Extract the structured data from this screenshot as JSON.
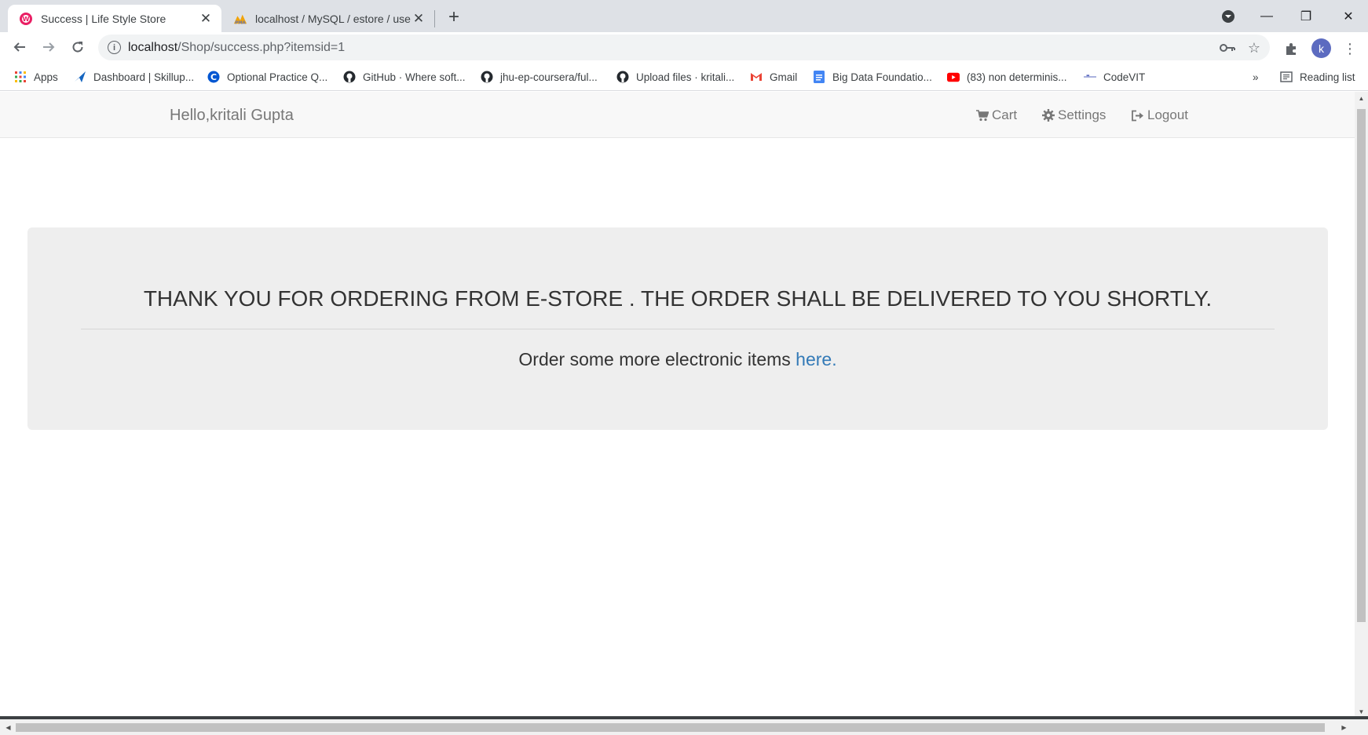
{
  "browser": {
    "tabs": [
      {
        "title": "Success | Life Style Store",
        "favicon": "store-favicon",
        "active": true
      },
      {
        "title": "localhost / MySQL / estore / user",
        "favicon": "phpmyadmin-favicon",
        "active": false
      }
    ],
    "new_tab_icon": "plus-icon",
    "address": {
      "host": "localhost",
      "path": "/Shop/success.php?itemsid=1"
    },
    "avatar_letter": "k",
    "bookmarks": [
      {
        "label": "Apps",
        "icon": "apps-grid-icon"
      },
      {
        "label": "Dashboard | Skillup...",
        "icon": "skillup-icon"
      },
      {
        "label": "Optional Practice Q...",
        "icon": "coursera-icon"
      },
      {
        "label": "GitHub · Where soft...",
        "icon": "github-icon"
      },
      {
        "label": "jhu-ep-coursera/ful...",
        "icon": "github-icon"
      },
      {
        "label": "Upload files · kritali...",
        "icon": "github-icon"
      },
      {
        "label": "Gmail",
        "icon": "gmail-icon"
      },
      {
        "label": "Big Data Foundatio...",
        "icon": "docs-icon"
      },
      {
        "label": "(83) non determinis...",
        "icon": "youtube-icon"
      },
      {
        "label": "CodeVIT",
        "icon": "codevit-icon"
      }
    ],
    "more_bookmarks": "»",
    "reading_list": "Reading list"
  },
  "page": {
    "navbar": {
      "greeting": "Hello,kritali Gupta",
      "links": [
        {
          "label": "Cart",
          "icon": "cart-icon"
        },
        {
          "label": "Settings",
          "icon": "gear-icon"
        },
        {
          "label": "Logout",
          "icon": "logout-icon"
        }
      ]
    },
    "message": {
      "heading": "THANK YOU FOR ORDERING FROM E-STORE . THE ORDER SHALL BE DELIVERED TO YOU SHORTLY.",
      "text": "Order some more electronic items ",
      "link_text": "here."
    }
  },
  "colors": {
    "link": "#337ab7",
    "jumbotron_bg": "#eeeeee",
    "navbar_bg": "#f8f8f8",
    "avatar": "#5c6bc0"
  }
}
